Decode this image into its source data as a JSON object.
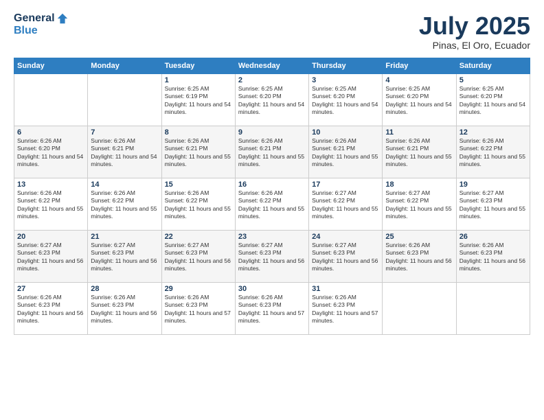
{
  "header": {
    "logo_general": "General",
    "logo_blue": "Blue",
    "title": "July 2025",
    "location": "Pinas, El Oro, Ecuador"
  },
  "weekdays": [
    "Sunday",
    "Monday",
    "Tuesday",
    "Wednesday",
    "Thursday",
    "Friday",
    "Saturday"
  ],
  "weeks": [
    [
      {
        "day": "",
        "info": ""
      },
      {
        "day": "",
        "info": ""
      },
      {
        "day": "1",
        "info": "Sunrise: 6:25 AM\nSunset: 6:19 PM\nDaylight: 11 hours and 54 minutes."
      },
      {
        "day": "2",
        "info": "Sunrise: 6:25 AM\nSunset: 6:20 PM\nDaylight: 11 hours and 54 minutes."
      },
      {
        "day": "3",
        "info": "Sunrise: 6:25 AM\nSunset: 6:20 PM\nDaylight: 11 hours and 54 minutes."
      },
      {
        "day": "4",
        "info": "Sunrise: 6:25 AM\nSunset: 6:20 PM\nDaylight: 11 hours and 54 minutes."
      },
      {
        "day": "5",
        "info": "Sunrise: 6:25 AM\nSunset: 6:20 PM\nDaylight: 11 hours and 54 minutes."
      }
    ],
    [
      {
        "day": "6",
        "info": "Sunrise: 6:26 AM\nSunset: 6:20 PM\nDaylight: 11 hours and 54 minutes."
      },
      {
        "day": "7",
        "info": "Sunrise: 6:26 AM\nSunset: 6:21 PM\nDaylight: 11 hours and 54 minutes."
      },
      {
        "day": "8",
        "info": "Sunrise: 6:26 AM\nSunset: 6:21 PM\nDaylight: 11 hours and 55 minutes."
      },
      {
        "day": "9",
        "info": "Sunrise: 6:26 AM\nSunset: 6:21 PM\nDaylight: 11 hours and 55 minutes."
      },
      {
        "day": "10",
        "info": "Sunrise: 6:26 AM\nSunset: 6:21 PM\nDaylight: 11 hours and 55 minutes."
      },
      {
        "day": "11",
        "info": "Sunrise: 6:26 AM\nSunset: 6:21 PM\nDaylight: 11 hours and 55 minutes."
      },
      {
        "day": "12",
        "info": "Sunrise: 6:26 AM\nSunset: 6:22 PM\nDaylight: 11 hours and 55 minutes."
      }
    ],
    [
      {
        "day": "13",
        "info": "Sunrise: 6:26 AM\nSunset: 6:22 PM\nDaylight: 11 hours and 55 minutes."
      },
      {
        "day": "14",
        "info": "Sunrise: 6:26 AM\nSunset: 6:22 PM\nDaylight: 11 hours and 55 minutes."
      },
      {
        "day": "15",
        "info": "Sunrise: 6:26 AM\nSunset: 6:22 PM\nDaylight: 11 hours and 55 minutes."
      },
      {
        "day": "16",
        "info": "Sunrise: 6:26 AM\nSunset: 6:22 PM\nDaylight: 11 hours and 55 minutes."
      },
      {
        "day": "17",
        "info": "Sunrise: 6:27 AM\nSunset: 6:22 PM\nDaylight: 11 hours and 55 minutes."
      },
      {
        "day": "18",
        "info": "Sunrise: 6:27 AM\nSunset: 6:22 PM\nDaylight: 11 hours and 55 minutes."
      },
      {
        "day": "19",
        "info": "Sunrise: 6:27 AM\nSunset: 6:23 PM\nDaylight: 11 hours and 55 minutes."
      }
    ],
    [
      {
        "day": "20",
        "info": "Sunrise: 6:27 AM\nSunset: 6:23 PM\nDaylight: 11 hours and 56 minutes."
      },
      {
        "day": "21",
        "info": "Sunrise: 6:27 AM\nSunset: 6:23 PM\nDaylight: 11 hours and 56 minutes."
      },
      {
        "day": "22",
        "info": "Sunrise: 6:27 AM\nSunset: 6:23 PM\nDaylight: 11 hours and 56 minutes."
      },
      {
        "day": "23",
        "info": "Sunrise: 6:27 AM\nSunset: 6:23 PM\nDaylight: 11 hours and 56 minutes."
      },
      {
        "day": "24",
        "info": "Sunrise: 6:27 AM\nSunset: 6:23 PM\nDaylight: 11 hours and 56 minutes."
      },
      {
        "day": "25",
        "info": "Sunrise: 6:26 AM\nSunset: 6:23 PM\nDaylight: 11 hours and 56 minutes."
      },
      {
        "day": "26",
        "info": "Sunrise: 6:26 AM\nSunset: 6:23 PM\nDaylight: 11 hours and 56 minutes."
      }
    ],
    [
      {
        "day": "27",
        "info": "Sunrise: 6:26 AM\nSunset: 6:23 PM\nDaylight: 11 hours and 56 minutes."
      },
      {
        "day": "28",
        "info": "Sunrise: 6:26 AM\nSunset: 6:23 PM\nDaylight: 11 hours and 56 minutes."
      },
      {
        "day": "29",
        "info": "Sunrise: 6:26 AM\nSunset: 6:23 PM\nDaylight: 11 hours and 57 minutes."
      },
      {
        "day": "30",
        "info": "Sunrise: 6:26 AM\nSunset: 6:23 PM\nDaylight: 11 hours and 57 minutes."
      },
      {
        "day": "31",
        "info": "Sunrise: 6:26 AM\nSunset: 6:23 PM\nDaylight: 11 hours and 57 minutes."
      },
      {
        "day": "",
        "info": ""
      },
      {
        "day": "",
        "info": ""
      }
    ]
  ]
}
